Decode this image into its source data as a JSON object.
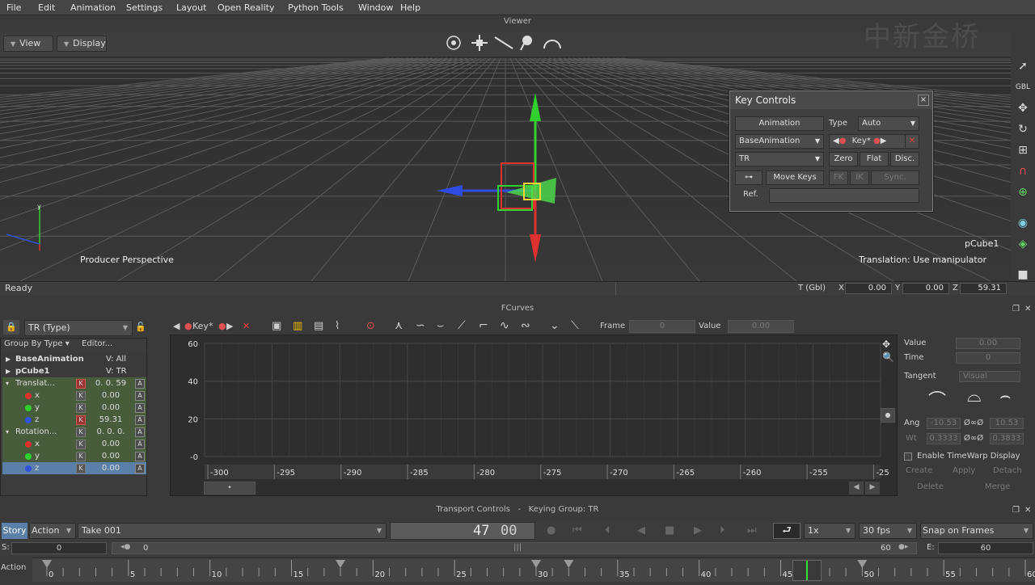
{
  "menu": [
    "File",
    "Edit",
    "Animation",
    "Settings",
    "Layout",
    "Open Reality",
    "Python Tools",
    "Window",
    "Help"
  ],
  "viewer": {
    "title": "Viewer",
    "view_label": "View",
    "display_label": "Display",
    "camera_label": "Producer Perspective",
    "selected_label": "pCube1",
    "hint": "Translation: Use manipulator",
    "watermark": "中新金桥"
  },
  "status": {
    "ready": "Ready",
    "t_label": "T (Gbl)",
    "x_label": "X",
    "x": "0.00",
    "y_label": "Y",
    "y": "0.00",
    "z_label": "Z",
    "z": "59.31"
  },
  "key_controls": {
    "title": "Key Controls",
    "animation_label": "Animation",
    "type_label": "Type",
    "type_value": "Auto",
    "layer_value": "BaseAnimation",
    "key_label": "Key*",
    "group_value": "TR",
    "zero_label": "Zero",
    "flat_label": "Flat",
    "disc_label": "Disc.",
    "move_keys_label": "Move Keys",
    "fk_label": "FK",
    "ik_label": "IK",
    "sync_label": "Sync.",
    "ref_label": "Ref."
  },
  "fcurves": {
    "title": "FCurves",
    "group_value": "TR (Type)",
    "group_by_label": "Group By Type",
    "editor_label": "Editor...",
    "key_label": "Key*",
    "frame_label": "Frame",
    "frame_value": "0",
    "value_label": "Value",
    "value_value": "0.00",
    "tree": [
      {
        "label": "BaseAnimation",
        "value": "V: All",
        "bold": true
      },
      {
        "label": "pCube1",
        "value": "V: TR",
        "bold": true
      },
      {
        "label": "Translat...",
        "value": "0. 0. 59",
        "key": "red"
      },
      {
        "label": "x",
        "value": "0.00",
        "color": "#e03030",
        "key": "grey"
      },
      {
        "label": "y",
        "value": "0.00",
        "color": "#30d030",
        "key": "grey"
      },
      {
        "label": "z",
        "value": "59.31",
        "color": "#3050e0",
        "key": "red"
      },
      {
        "label": "Rotation...",
        "value": "0. 0. 0.",
        "key": "grey"
      },
      {
        "label": "x",
        "value": "0.00",
        "color": "#e03030",
        "key": "grey"
      },
      {
        "label": "y",
        "value": "0.00",
        "color": "#30d030",
        "key": "grey"
      },
      {
        "label": "z",
        "value": "0.00",
        "color": "#3050e0",
        "key": "grey",
        "selected": true
      }
    ],
    "y_ticks": [
      "60",
      "40",
      "20",
      "-0"
    ],
    "x_ticks": [
      "-300",
      "-295",
      "-290",
      "-285",
      "-280",
      "-275",
      "-270",
      "-265",
      "-260",
      "-255",
      "-25"
    ],
    "right": {
      "value_label": "Value",
      "value": "0.00",
      "time_label": "Time",
      "time": "0",
      "tangent_label": "Tangent",
      "tangent_value": "Visual",
      "ang_label": "Ang",
      "ang_left": "-10.53",
      "ang_right": "10.53",
      "wt_label": "Wt",
      "wt_left": "0.3333",
      "wt_right": "0.3833",
      "timewarp_label": "Enable TimeWarp Display",
      "create_label": "Create",
      "apply_label": "Apply",
      "detach_label": "Detach",
      "delete_label": "Delete",
      "merge_label": "Merge"
    }
  },
  "transport": {
    "title": "Transport Controls",
    "dash": "-",
    "keying_group": "Keying Group: TR",
    "story_label": "Story",
    "action_label": "Action",
    "take_value": "Take 001",
    "current_frame": "47",
    "frame_suffix": "00",
    "speed_value": "1x",
    "fps_value": "30 fps",
    "snap_value": "Snap on Frames",
    "start_label": "S:",
    "start_value": "0",
    "range_start": "0",
    "range_end": "60",
    "end_label": "E:",
    "end_value": "60",
    "timeline_label": "Action",
    "timeline_ticks": [
      "0",
      "5",
      "10",
      "15",
      "20",
      "25",
      "30",
      "35",
      "40",
      "45",
      "50",
      "55",
      "60"
    ]
  },
  "colors": {
    "x_axis": "#e03030",
    "y_axis": "#30d030",
    "z_axis": "#2f4be0",
    "selection": "#ffd633"
  }
}
